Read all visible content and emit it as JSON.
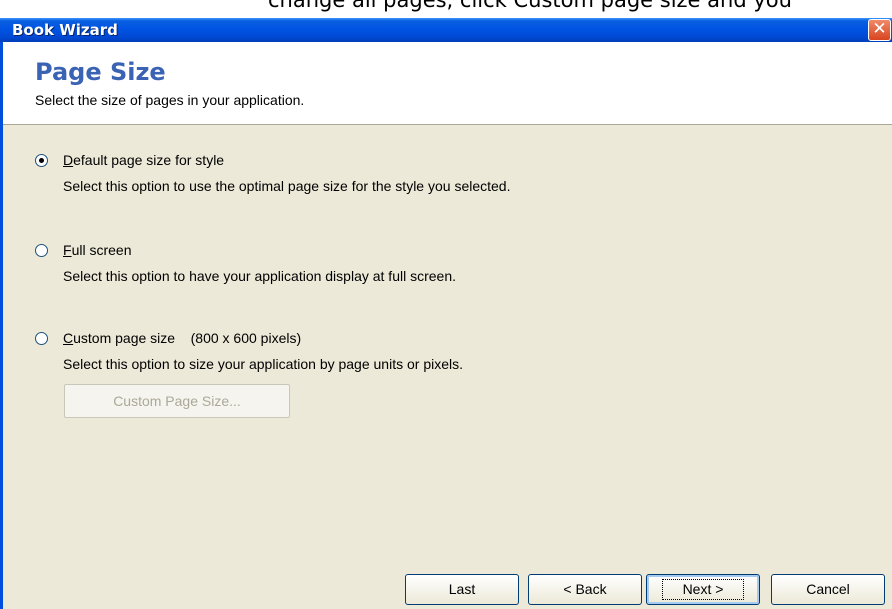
{
  "top_strip_text": "change all pages, click Custom page size and you",
  "window": {
    "title": "Book Wizard",
    "close_glyph": "✕"
  },
  "header": {
    "title": "Page Size",
    "subtitle": "Select the size of pages in your application."
  },
  "options": [
    {
      "label_mnemonic": "D",
      "label_rest": "efault page size for style",
      "description": "Select this option to use the optimal page size for the style you selected.",
      "checked": true
    },
    {
      "label_mnemonic": "F",
      "label_rest": "ull screen",
      "description": "Select this option to have your application display at full screen.",
      "checked": false
    },
    {
      "label_mnemonic": "C",
      "label_rest": "ustom page size    (800 x 600 pixels)",
      "description": "Select this option to size your application by page units or pixels.",
      "checked": false
    }
  ],
  "custom_button": {
    "label": "Custom Page Size...",
    "enabled": false
  },
  "buttons": {
    "last": "Last",
    "back": "< Back",
    "next": "Next >",
    "cancel": "Cancel"
  },
  "colors": {
    "title_bar": "#0054e3",
    "header_title": "#3a63b4",
    "dialog_background": "#ece9d8"
  }
}
